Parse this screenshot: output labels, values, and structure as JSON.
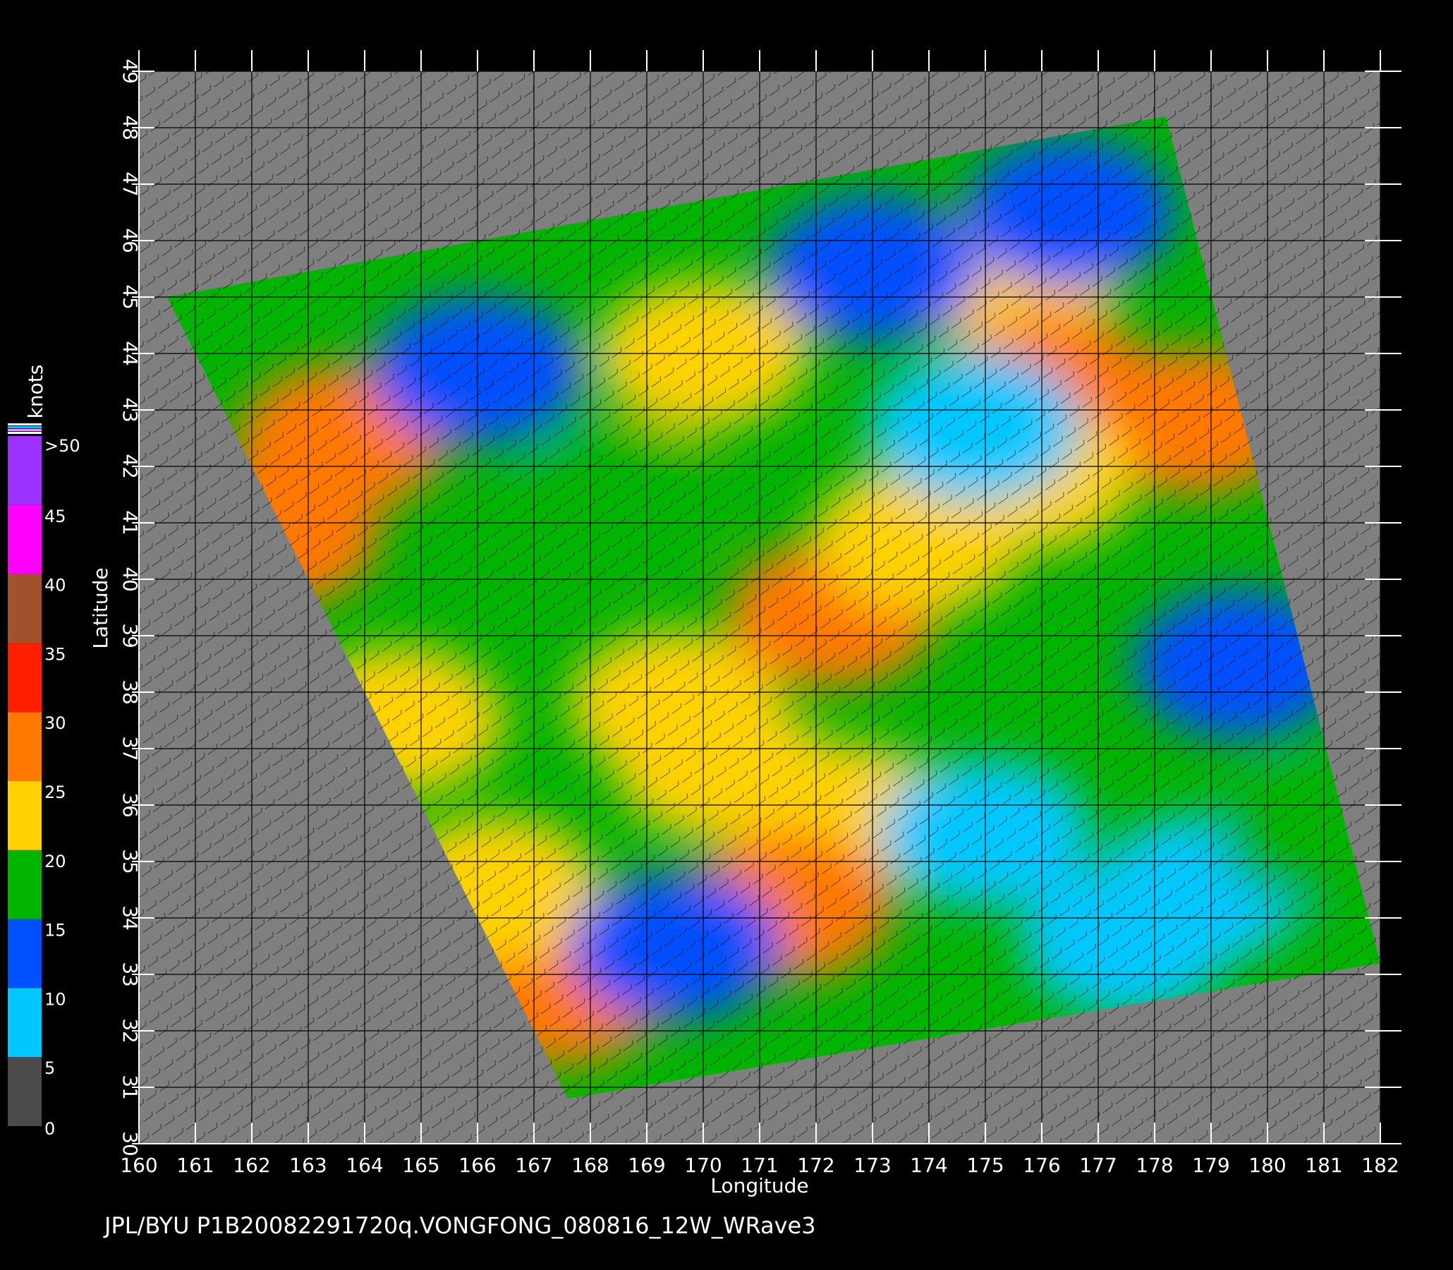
{
  "map": {
    "x_axis_label": "Longitude",
    "y_axis_label": "Latitude",
    "longitude_ticks": [
      "160",
      "161",
      "162",
      "163",
      "164",
      "165",
      "166",
      "167",
      "168",
      "169",
      "170",
      "171",
      "172",
      "173",
      "174",
      "175",
      "176",
      "177",
      "178",
      "179",
      "180",
      "181",
      "182"
    ],
    "latitude_ticks": [
      "30",
      "31",
      "32",
      "33",
      "34",
      "35",
      "36",
      "37",
      "38",
      "39",
      "40",
      "41",
      "42",
      "43",
      "44",
      "45",
      "46",
      "47",
      "48",
      "49"
    ],
    "lon_range": [
      160,
      182
    ],
    "lat_range": [
      30,
      49
    ],
    "swath_corners_lonlat": [
      [
        160.5,
        45.0
      ],
      [
        178.2,
        48.2
      ],
      [
        182.0,
        33.2
      ],
      [
        167.6,
        30.8
      ]
    ],
    "colors": {
      "land_no_data": "#7f7f7f",
      "grid": "#000000",
      "axes": "#ffffff"
    },
    "wind_features": [
      {
        "lon": 162.4,
        "lat": 40.8,
        "speed": 28
      },
      {
        "lon": 163.6,
        "lat": 42.5,
        "speed": 27
      },
      {
        "lon": 164.6,
        "lat": 37.5,
        "speed": 24
      },
      {
        "lon": 170.0,
        "lat": 44.0,
        "speed": 20
      },
      {
        "lon": 168.5,
        "lat": 41.5,
        "speed": 19
      },
      {
        "lon": 169.5,
        "lat": 37.8,
        "speed": 21
      },
      {
        "lon": 175.5,
        "lat": 45.3,
        "speed": 24
      },
      {
        "lon": 176.2,
        "lat": 43.4,
        "speed": 26
      },
      {
        "lon": 178.7,
        "lat": 42.8,
        "speed": 27
      },
      {
        "lon": 172.3,
        "lat": 39.4,
        "speed": 26
      },
      {
        "lon": 173.8,
        "lat": 40.7,
        "speed": 23
      },
      {
        "lon": 175.8,
        "lat": 41.8,
        "speed": 22
      },
      {
        "lon": 170.3,
        "lat": 36.7,
        "speed": 22
      },
      {
        "lon": 172.5,
        "lat": 35.8,
        "speed": 21
      },
      {
        "lon": 171.5,
        "lat": 34.2,
        "speed": 25
      },
      {
        "lon": 167.5,
        "lat": 32.7,
        "speed": 27
      },
      {
        "lon": 166.3,
        "lat": 34.5,
        "speed": 24
      },
      {
        "lon": 166.0,
        "lat": 43.7,
        "speed": 10
      },
      {
        "lon": 174.8,
        "lat": 42.7,
        "speed": 9
      },
      {
        "lon": 173.0,
        "lat": 45.5,
        "speed": 11
      },
      {
        "lon": 176.5,
        "lat": 46.5,
        "speed": 12
      },
      {
        "lon": 178.8,
        "lat": 34.5,
        "speed": 6
      },
      {
        "lon": 177.5,
        "lat": 33.6,
        "speed": 5
      },
      {
        "lon": 175.0,
        "lat": 35.5,
        "speed": 9
      },
      {
        "lon": 169.5,
        "lat": 33.5,
        "speed": 11
      },
      {
        "lon": 179.5,
        "lat": 38.5,
        "speed": 12
      },
      {
        "lon": 181.0,
        "lat": 35.5,
        "speed": 16
      }
    ]
  },
  "legend": {
    "unit_label": "knots",
    "tick_labels": [
      ">50",
      "45",
      "40",
      "35",
      "30",
      "25",
      "20",
      "15",
      "10",
      "5",
      "0"
    ],
    "bands": [
      {
        "from": 0,
        "to": 5,
        "color": "#4a4a4a"
      },
      {
        "from": 5,
        "to": 10,
        "color": "#00c8ff"
      },
      {
        "from": 10,
        "to": 15,
        "color": "#0050ff"
      },
      {
        "from": 15,
        "to": 20,
        "color": "#00b400"
      },
      {
        "from": 20,
        "to": 25,
        "color": "#ffd200"
      },
      {
        "from": 25,
        "to": 30,
        "color": "#ff7800"
      },
      {
        "from": 30,
        "to": 35,
        "color": "#ff1e00"
      },
      {
        "from": 35,
        "to": 40,
        "color": "#a0522d"
      },
      {
        "from": 40,
        "to": 45,
        "color": "#ff00ff"
      },
      {
        "from": 45,
        "to": 50,
        "color": "#9b30ff"
      }
    ]
  },
  "footer": {
    "caption": "JPL/BYU  P1B20082291720q.VONGFONG_080816_12W_WRave3"
  }
}
